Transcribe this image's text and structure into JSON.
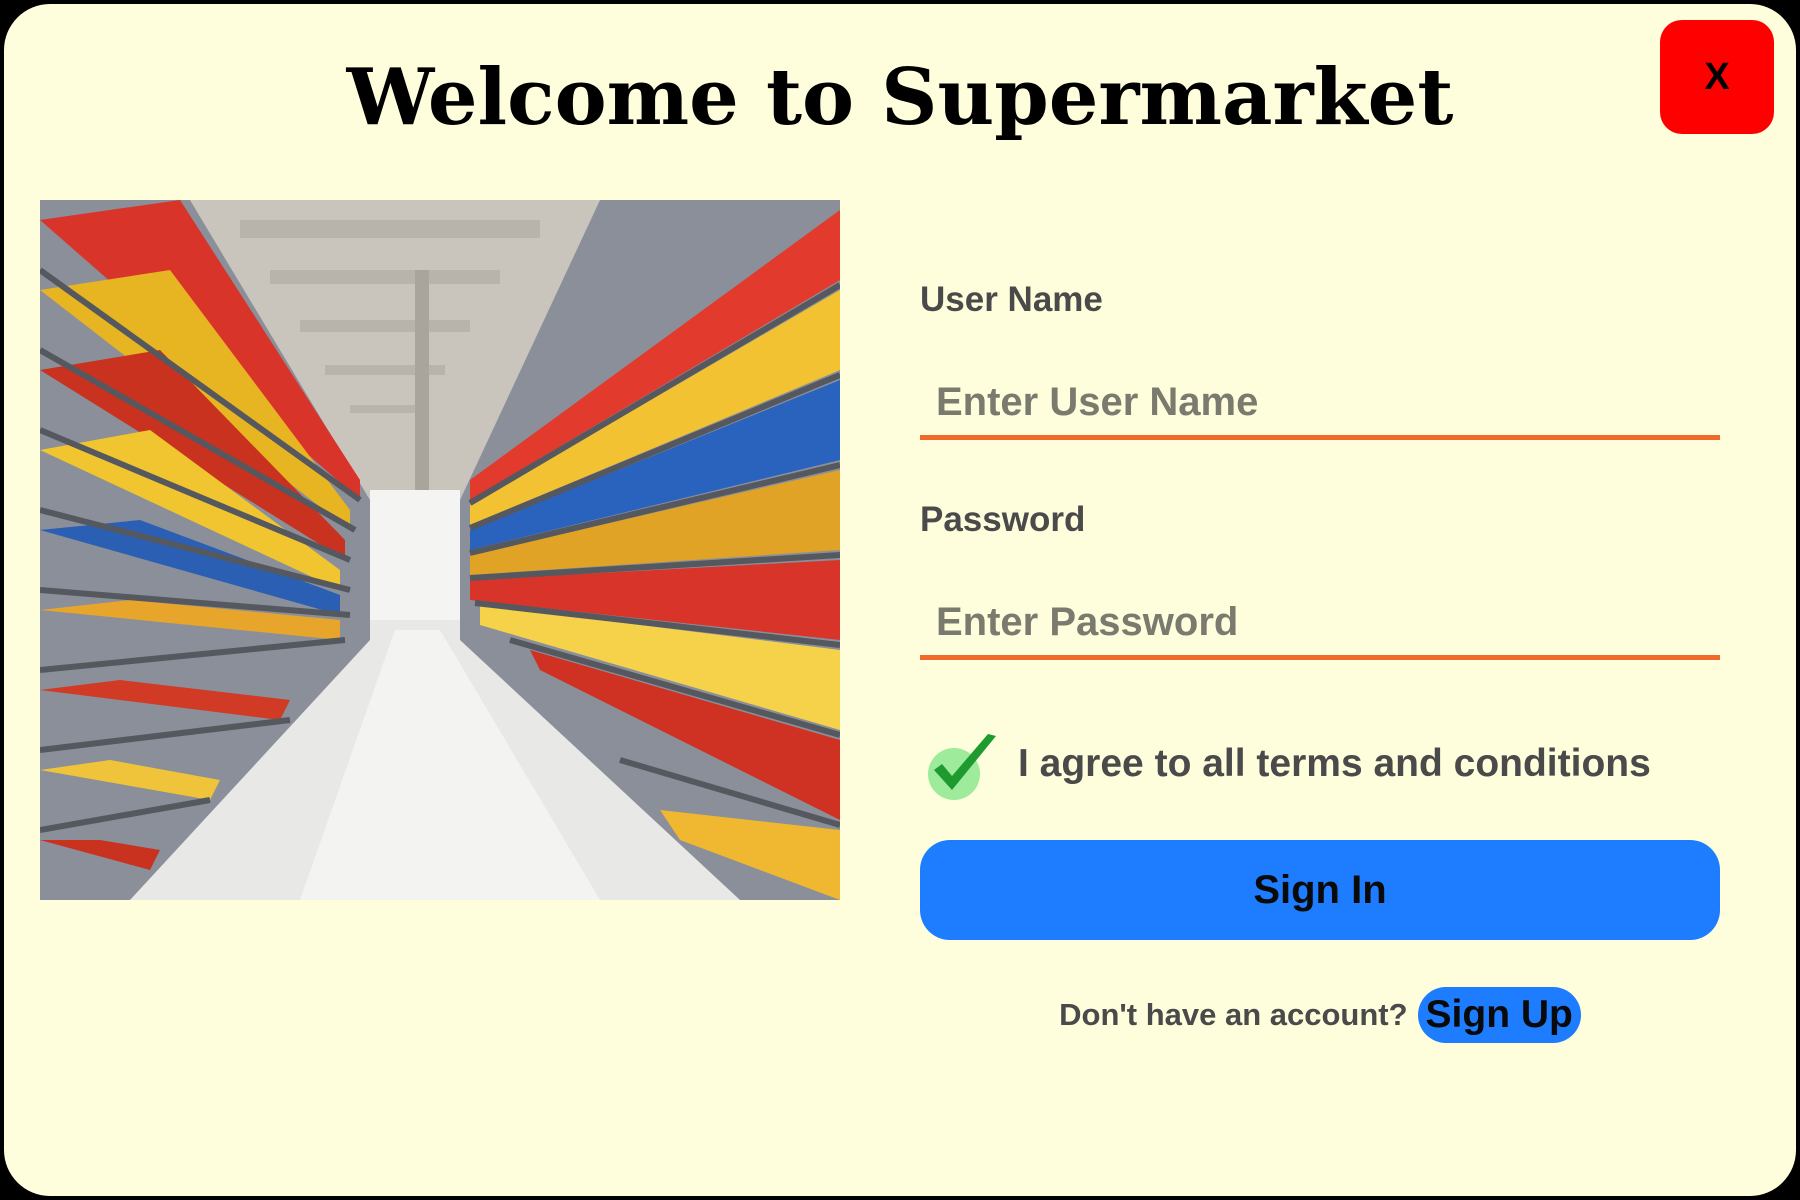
{
  "header": {
    "title": "Welcome to Supermarket",
    "close_label": "X"
  },
  "image": {
    "icon": "supermarket-aisle-photo"
  },
  "form": {
    "username": {
      "label": "User Name",
      "placeholder": "Enter User Name",
      "value": ""
    },
    "password": {
      "label": "Password",
      "placeholder": "Enter Password",
      "value": ""
    },
    "terms": {
      "label": "I agree to all terms and conditions",
      "checked": true
    },
    "signin_label": "Sign In",
    "signup_prompt": "Don't have an account?",
    "signup_label": "Sign Up"
  },
  "colors": {
    "background": "#FEFDDC",
    "close_button": "#FF0000",
    "accent_blue": "#1E7CFF",
    "input_underline": "#F06A2A",
    "check_green": "#1F9A2E"
  }
}
